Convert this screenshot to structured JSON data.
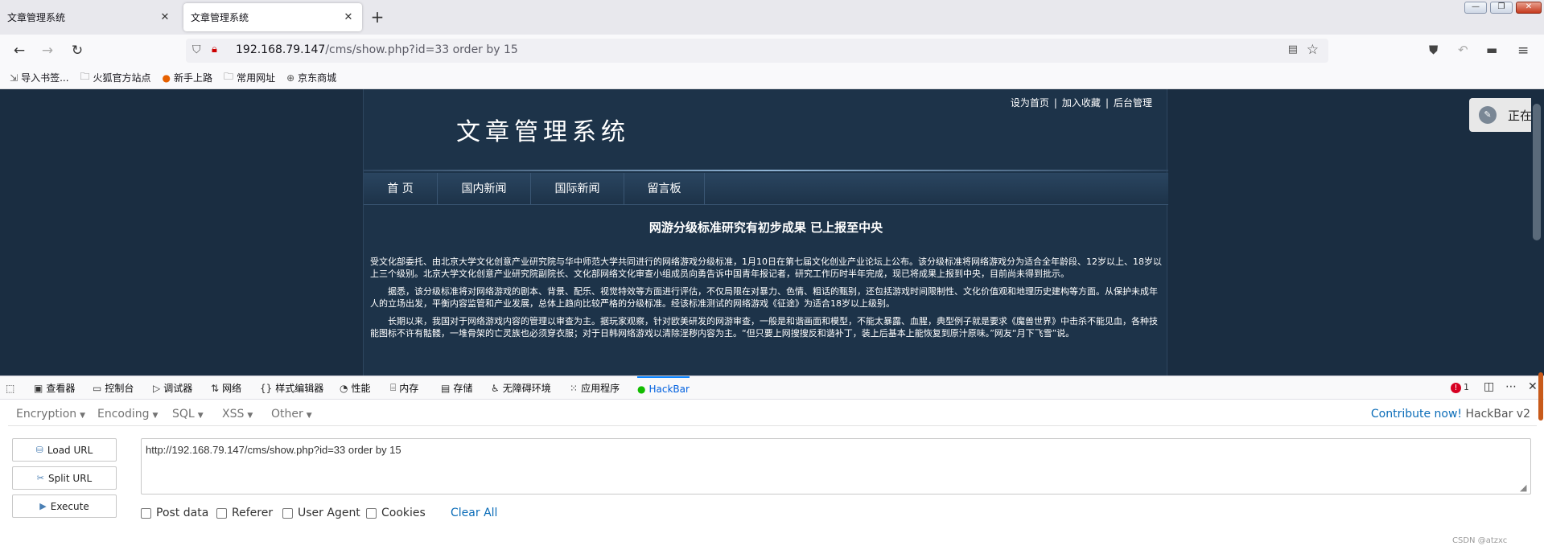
{
  "browser": {
    "tabs": [
      {
        "title": "文章管理系统",
        "close": "✕"
      },
      {
        "title": "文章管理系统",
        "close": "✕"
      }
    ],
    "new_tab": "+",
    "window_controls": {
      "minimize": "—",
      "maximize": "❐",
      "close": "✕"
    },
    "nav": {
      "back": "←",
      "forward": "→",
      "reload": "↻"
    },
    "url": {
      "host": "192.168.79.147",
      "path": "/cms/show.php?id=33 order by 15"
    },
    "right_icons": [
      "pocket-icon",
      "undo-icon",
      "screen-icon",
      "menu-icon"
    ],
    "bookmarks": [
      {
        "label": "导入书签...",
        "icon": "import-icon"
      },
      {
        "label": "火狐官方站点",
        "icon": "folder-icon"
      },
      {
        "label": "新手上路",
        "icon": "firefox-icon"
      },
      {
        "label": "常用网址",
        "icon": "folder-icon"
      },
      {
        "label": "京东商城",
        "icon": "globe-icon"
      }
    ]
  },
  "site": {
    "top_links": [
      "设为首页",
      "加入收藏",
      "后台管理"
    ],
    "top_link_sep": "|",
    "title": "文章管理系统",
    "nav": [
      "首 页",
      "国内新闻",
      "国际新闻",
      "留言板"
    ],
    "article": {
      "title": "网游分级标准研究有初步成果 已上报至中央",
      "paragraphs": [
        "受文化部委托、由北京大学文化创意产业研究院与华中师范大学共同进行的网络游戏分级标准，1月10日在第七届文化创业产业论坛上公布。该分级标准将网络游戏分为适合全年龄段、12岁以上、18岁以上三个级别。北京大学文化创意产业研究院副院长、文化部网络文化审查小组成员向勇告诉中国青年报记者，研究工作历时半年完成，现已将成果上报到中央，目前尚未得到批示。",
        "据悉，该分级标准将对网络游戏的剧本、背景、配乐、视觉特效等方面进行评估，不仅局限在对暴力、色情、粗话的甄别，还包括游戏时间限制性、文化价值观和地理历史建构等方面。从保护未成年人的立场出发，平衡内容监管和产业发展，总体上趋向比较严格的分级标准。经该标准测试的网络游戏《征途》为适合18岁以上级别。",
        "长期以来，我国对于网络游戏内容的管理以审查为主。据玩家观察，针对欧美研发的网游审查，一般是和谐画面和模型，不能太暴露、血腥，典型例子就是要求《魔兽世界》中击杀不能见血，各种技能图标不许有骷髅，一堆骨架的亡灵族也必须穿衣服；对于日韩网络游戏以清除淫秽内容为主。“但只要上网搜搜反和谐补丁，装上后基本上能恢复到原汁原味。”网友“月下飞雪”说。"
      ]
    },
    "toast": "正在讲"
  },
  "devtools": {
    "tabs": [
      {
        "label": "",
        "icon": "picker-icon"
      },
      {
        "label": "查看器",
        "icon": "inspector-icon"
      },
      {
        "label": "控制台",
        "icon": "console-icon"
      },
      {
        "label": "调试器",
        "icon": "debugger-icon"
      },
      {
        "label": "网络",
        "icon": "network-icon"
      },
      {
        "label": "样式编辑器",
        "icon": "style-icon"
      },
      {
        "label": "性能",
        "icon": "performance-icon"
      },
      {
        "label": "内存",
        "icon": "memory-icon"
      },
      {
        "label": "存储",
        "icon": "storage-icon"
      },
      {
        "label": "无障碍环境",
        "icon": "accessibility-icon"
      },
      {
        "label": "应用程序",
        "icon": "application-icon"
      },
      {
        "label": "HackBar",
        "icon": "hackbar-icon"
      }
    ],
    "active_tab": "HackBar",
    "error_count": "1"
  },
  "hackbar": {
    "menus": [
      "Encryption",
      "Encoding",
      "SQL",
      "XSS",
      "Other"
    ],
    "contribute_link": "Contribute now!",
    "version": "HackBar v2",
    "buttons": {
      "load": "Load URL",
      "split": "Split URL",
      "execute": "Execute"
    },
    "url_value": "http://192.168.79.147/cms/show.php?id=33 order by 15",
    "checkboxes": [
      "Post data",
      "Referer",
      "User Agent",
      "Cookies"
    ],
    "clear_all": "Clear All",
    "watermark": "CSDN @atzxc"
  },
  "colors": {
    "page_bg": "#1a2d41",
    "accent": "#0a84ff",
    "link": "#0a6cb8"
  }
}
